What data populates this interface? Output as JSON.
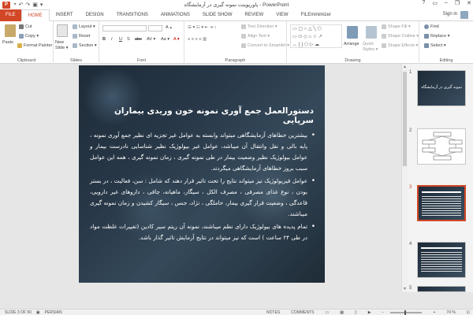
{
  "window": {
    "title": "پاورپوینت نمونه گیری در آزمایشگاه - PowerPoint",
    "app_icon": "P",
    "controls": [
      "?",
      "▭",
      "–",
      "❐",
      "✕"
    ]
  },
  "tabs": [
    "FILE",
    "HOME",
    "INSERT",
    "DESIGN",
    "TRANSITIONS",
    "ANIMATIONS",
    "SLIDE SHOW",
    "REVIEW",
    "VIEW",
    "FILEminimizer"
  ],
  "active_tab": "HOME",
  "signin": "Sign in",
  "ribbon": {
    "clipboard": {
      "label": "Clipboard",
      "paste": "Paste",
      "cut": "Cut",
      "copy": "Copy ▾",
      "format_painter": "Format Painter"
    },
    "slides": {
      "label": "Slides",
      "new_slide": "New Slide ▾",
      "layout": "Layout ▾",
      "reset": "Reset",
      "section": "Section ▾"
    },
    "font": {
      "label": "Font",
      "buttons": [
        "B",
        "I",
        "U",
        "S",
        "abc",
        "AV ▾",
        "Aa ▾",
        "A ▾"
      ]
    },
    "paragraph": {
      "label": "Paragraph",
      "text_direction": "Text Direction ▾",
      "align_text": "Align Text ▾",
      "convert_smartart": "Convert to SmartArt ▾"
    },
    "drawing": {
      "label": "Drawing",
      "arrange": "Arrange",
      "quick_styles": "Quick Styles ▾",
      "shape_fill": "Shape Fill ▾",
      "shape_outline": "Shape Outline ▾",
      "shape_effects": "Shape Effects ▾"
    },
    "editing": {
      "label": "Editing",
      "find": "Find",
      "replace": "Replace ▾",
      "select": "Select ▾"
    }
  },
  "slide": {
    "title": "دستورالعمل جمع آوری نمونه خون وریدی بیماران سرپایی",
    "bullets": [
      "بیشترین خطاهای آزمایشگاهی میتواند وابسته به عوامل غیر تجزیه ای نظیر جمع آوری نمونه ، پایه بالی و نقل وانتقال آن میباشد، عوامل غیر بیولوژیک نظیر شناسایی نادرست بیمار و عوامل بیولوژیک نظیر وضعیت بیمار در طی نمونه گیری ، زمان نمونه گیری ، همه این عوامل سبب بروز خطاهای آزمایشگاهی میگردند.",
      "عوامل فیزیولوژیک نیز میتواند نتایج را تحت تاثیر قرار دهند که شامل : سن، فعالیت ، در بستر بودن ، نوع غذای مصرفی ، مصرف الکل ، سیگار، ماهیانه، چاقی ، داروهای غیر دارویی، قاعدگی ، وضعیت قرار گیری بیمار، حاملگی ، نژاد، جنس ، سیگار کشیدن و زمان نمونه گیری میباشند.",
      "تمام پدیده های بیولوژیک دارای نظم میباشند، نمونه آن ریتم سیر کادین (تغییرات غلظت مواد در طی ۲۴ ساعت ) است که نیز میتواند در نتایج آزمایش تاثیر گذار باشد."
    ]
  },
  "thumbnails": [
    {
      "number": "1",
      "title": "نمونه گیری در آزمایشگاه"
    },
    {
      "number": "2",
      "title": ""
    },
    {
      "number": "3",
      "title": ""
    },
    {
      "number": "4",
      "title": ""
    },
    {
      "number": "5",
      "title": ""
    }
  ],
  "status": {
    "slide_info": "SLIDE 3 OF 50",
    "language": "PERSIAN",
    "notes": "NOTES",
    "comments": "COMMENTS",
    "zoom": "74 %"
  },
  "colors": {
    "accent": "#d24726",
    "slide_bg": "#283848"
  }
}
